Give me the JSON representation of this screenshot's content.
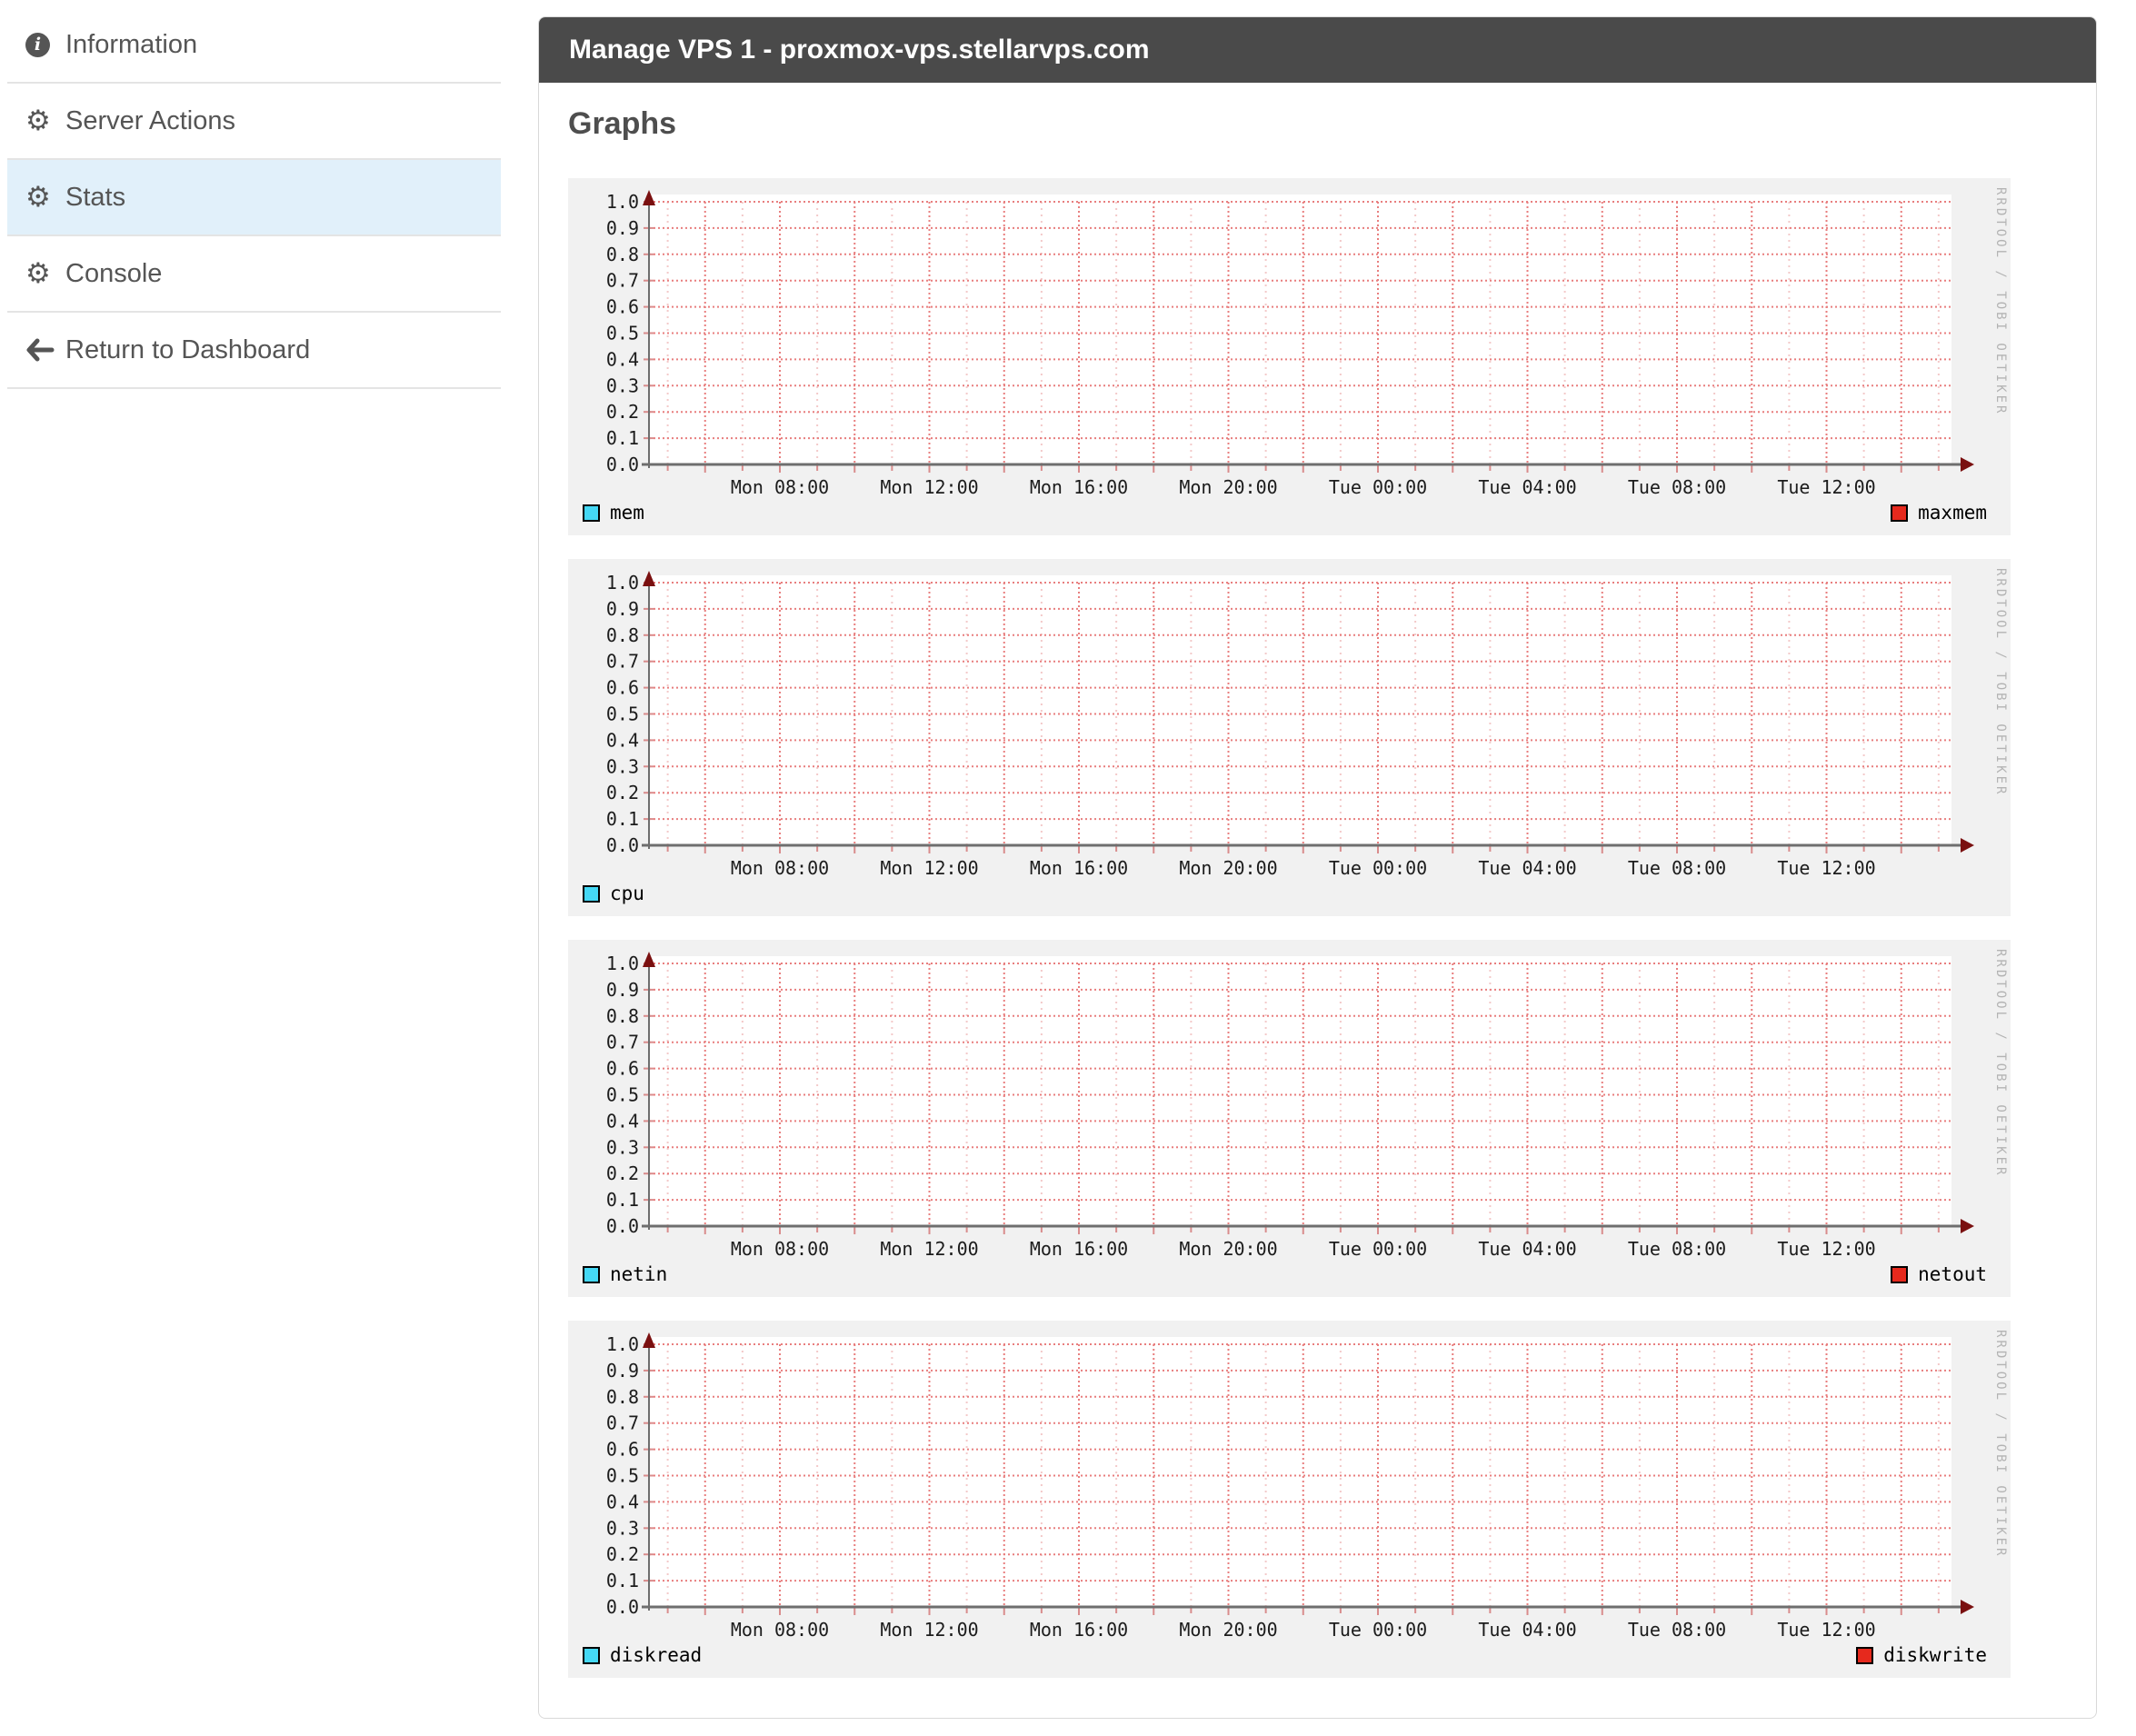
{
  "sidebar": {
    "items": [
      {
        "label": "Information",
        "icon": "info-circle-icon",
        "active": false
      },
      {
        "label": "Server Actions",
        "icon": "gear-icon",
        "active": false
      },
      {
        "label": "Stats",
        "icon": "gear-icon",
        "active": true
      },
      {
        "label": "Console",
        "icon": "gear-icon",
        "active": false
      },
      {
        "label": "Return to Dashboard",
        "icon": "arrow-left-icon",
        "active": false
      }
    ]
  },
  "panel": {
    "title": "Manage VPS 1 - proxmox-vps.stellarvps.com",
    "section_heading": "Graphs"
  },
  "colors": {
    "header_bg": "#4a4a4a",
    "header_text": "#ffffff",
    "active_item_bg": "#e1f0fa",
    "sidebar_text": "#555555",
    "graph_bg": "#f1f1f1",
    "plot_bg": "#ffffff",
    "grid_major": "#e87e7e",
    "grid_minor": "#f3c9c9",
    "tick": "#d98c8c",
    "axis": "#6e6e6e",
    "arrow": "#7a1010",
    "label_text": "#1c1c1c",
    "legend_cyan": "#45d8f5",
    "legend_red": "#e6291d",
    "watermark": "#b3b3b3"
  },
  "chart_data": [
    {
      "id": "mem",
      "type": "line",
      "title": "",
      "xlabel": "",
      "ylabel": "",
      "ylim": [
        0.0,
        1.0
      ],
      "y_tick_labels": [
        "0.0",
        "0.1",
        "0.2",
        "0.3",
        "0.4",
        "0.5",
        "0.6",
        "0.7",
        "0.8",
        "0.9",
        "1.0"
      ],
      "x_tick_labels": [
        "Mon 08:00",
        "Mon 12:00",
        "Mon 16:00",
        "Mon 20:00",
        "Tue 00:00",
        "Tue 04:00",
        "Tue 08:00",
        "Tue 12:00"
      ],
      "minor_grid_interval_hours": 1,
      "major_grid_interval_hours": 2,
      "label_interval_hours": 4,
      "grid": true,
      "legend_position": "bottom",
      "watermark": "RRDTOOL / TOBI OETIKER",
      "series": [
        {
          "name": "mem",
          "color": "#45d8f5",
          "values": []
        },
        {
          "name": "maxmem",
          "color": "#e6291d",
          "values": []
        }
      ],
      "note": "empty graph - no data plotted"
    },
    {
      "id": "cpu",
      "type": "line",
      "title": "",
      "xlabel": "",
      "ylabel": "",
      "ylim": [
        0.0,
        1.0
      ],
      "y_tick_labels": [
        "0.0",
        "0.1",
        "0.2",
        "0.3",
        "0.4",
        "0.5",
        "0.6",
        "0.7",
        "0.8",
        "0.9",
        "1.0"
      ],
      "x_tick_labels": [
        "Mon 08:00",
        "Mon 12:00",
        "Mon 16:00",
        "Mon 20:00",
        "Tue 00:00",
        "Tue 04:00",
        "Tue 08:00",
        "Tue 12:00"
      ],
      "minor_grid_interval_hours": 1,
      "major_grid_interval_hours": 2,
      "label_interval_hours": 4,
      "grid": true,
      "legend_position": "bottom",
      "watermark": "RRDTOOL / TOBI OETIKER",
      "series": [
        {
          "name": "cpu",
          "color": "#45d8f5",
          "values": []
        }
      ],
      "note": "empty graph - no data plotted"
    },
    {
      "id": "net",
      "type": "line",
      "title": "",
      "xlabel": "",
      "ylabel": "",
      "ylim": [
        0.0,
        1.0
      ],
      "y_tick_labels": [
        "0.0",
        "0.1",
        "0.2",
        "0.3",
        "0.4",
        "0.5",
        "0.6",
        "0.7",
        "0.8",
        "0.9",
        "1.0"
      ],
      "x_tick_labels": [
        "Mon 08:00",
        "Mon 12:00",
        "Mon 16:00",
        "Mon 20:00",
        "Tue 00:00",
        "Tue 04:00",
        "Tue 08:00",
        "Tue 12:00"
      ],
      "minor_grid_interval_hours": 1,
      "major_grid_interval_hours": 2,
      "label_interval_hours": 4,
      "grid": true,
      "legend_position": "bottom",
      "watermark": "RRDTOOL / TOBI OETIKER",
      "series": [
        {
          "name": "netin",
          "color": "#45d8f5",
          "values": []
        },
        {
          "name": "netout",
          "color": "#e6291d",
          "values": []
        }
      ],
      "note": "empty graph - no data plotted"
    },
    {
      "id": "disk",
      "type": "line",
      "title": "",
      "xlabel": "",
      "ylabel": "",
      "ylim": [
        0.0,
        1.0
      ],
      "y_tick_labels": [
        "0.0",
        "0.1",
        "0.2",
        "0.3",
        "0.4",
        "0.5",
        "0.6",
        "0.7",
        "0.8",
        "0.9",
        "1.0"
      ],
      "x_tick_labels": [
        "Mon 08:00",
        "Mon 12:00",
        "Mon 16:00",
        "Mon 20:00",
        "Tue 00:00",
        "Tue 04:00",
        "Tue 08:00",
        "Tue 12:00"
      ],
      "minor_grid_interval_hours": 1,
      "major_grid_interval_hours": 2,
      "label_interval_hours": 4,
      "grid": true,
      "legend_position": "bottom",
      "watermark": "RRDTOOL / TOBI OETIKER",
      "series": [
        {
          "name": "diskread",
          "color": "#45d8f5",
          "values": []
        },
        {
          "name": "diskwrite",
          "color": "#e6291d",
          "values": []
        }
      ],
      "note": "empty graph - no data plotted"
    }
  ]
}
